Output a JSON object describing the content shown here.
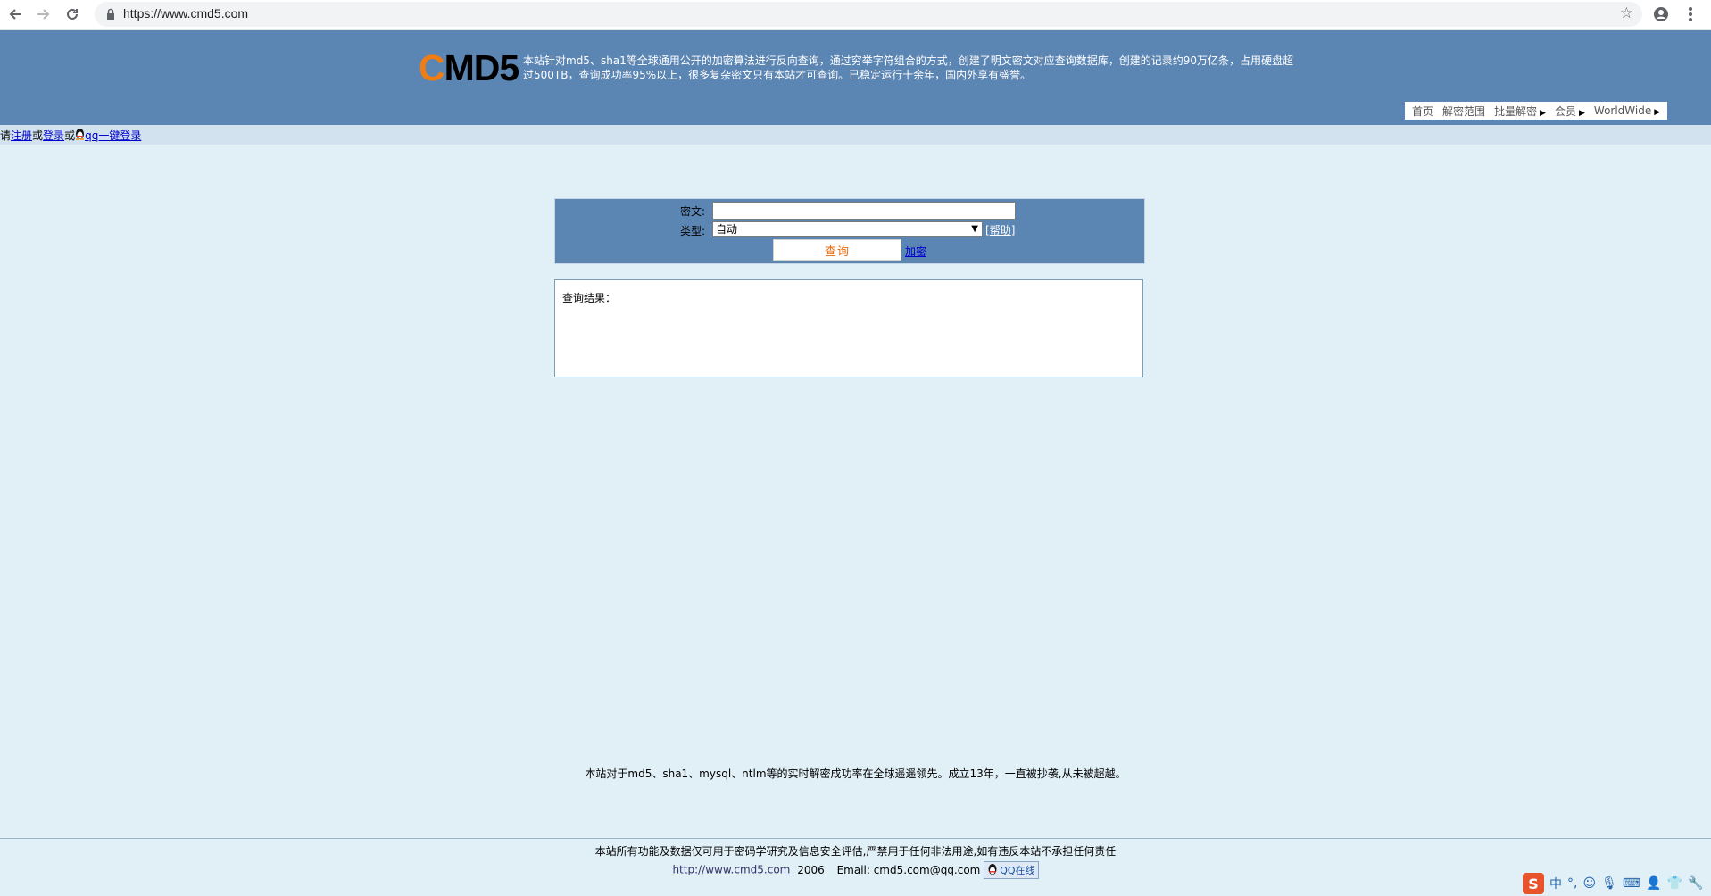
{
  "browser": {
    "url": "https://www.cmd5.com"
  },
  "header": {
    "logo_c": "C",
    "logo_rest": "MD5",
    "intro": "本站针对md5、sha1等全球通用公开的加密算法进行反向查询，通过穷举字符组合的方式，创建了明文密文对应查询数据库，创建的记录约90万亿条，占用硬盘超过500TB，查询成功率95%以上，很多复杂密文只有本站才可查询。已稳定运行十余年，国内外享有盛誉。",
    "nav": [
      "首页",
      "解密范围",
      "批量解密",
      "会员",
      "WorldWide"
    ]
  },
  "login": {
    "prefix": "请",
    "register": "注册",
    "or1": "或",
    "login": "登录",
    "or2": "或",
    "qq_login": "qq一键登录"
  },
  "form": {
    "cipher_label": "密文:",
    "cipher_value": "",
    "type_label": "类型:",
    "type_value": "自动",
    "help": "帮助",
    "query_button": "查询",
    "encrypt_link": "加密"
  },
  "result": {
    "label": "查询结果："
  },
  "claim": "本站对于md5、sha1、mysql、ntlm等的实时解密成功率在全球遥遥领先。成立13年，一直被抄袭,从未被超越。",
  "footer": {
    "disclaimer": "本站所有功能及数据仅可用于密码学研究及信息安全评估,严禁用于任何非法用途,如有违反本站不承担任何责任",
    "site_link": "http://www.cmd5.com",
    "year": "2006",
    "email": "Email: cmd5.com@qq.com",
    "qq_online": "QQ在线"
  },
  "ime": {
    "lang": "中"
  }
}
